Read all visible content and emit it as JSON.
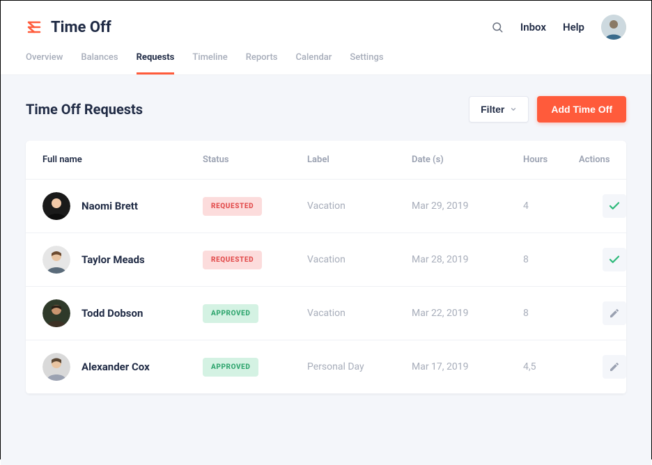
{
  "header": {
    "app_title": "Time Off",
    "links": {
      "inbox": "Inbox",
      "help": "Help"
    }
  },
  "tabs": [
    {
      "label": "Overview"
    },
    {
      "label": "Balances"
    },
    {
      "label": "Requests"
    },
    {
      "label": "Timeline"
    },
    {
      "label": "Reports"
    },
    {
      "label": "Calendar"
    },
    {
      "label": "Settings"
    }
  ],
  "page": {
    "title": "Time Off Requests",
    "filter_label": "Filter",
    "add_label": "Add Time Off"
  },
  "table": {
    "columns": {
      "name": "Full name",
      "status": "Status",
      "label": "Label",
      "date": "Date (s)",
      "hours": "Hours",
      "actions": "Actions"
    },
    "rows": [
      {
        "name": "Naomi Brett",
        "status": "REQUESTED",
        "status_kind": "requested",
        "label": "Vacation",
        "date": "Mar 29, 2019",
        "hours": "4",
        "action_set": "pending"
      },
      {
        "name": "Taylor Meads",
        "status": "REQUESTED",
        "status_kind": "requested",
        "label": "Vacation",
        "date": "Mar 28, 2019",
        "hours": "8",
        "action_set": "pending"
      },
      {
        "name": "Todd Dobson",
        "status": "APPROVED",
        "status_kind": "approved",
        "label": "Vacation",
        "date": "Mar 22, 2019",
        "hours": "8",
        "action_set": "edit"
      },
      {
        "name": "Alexander Cox",
        "status": "APPROVED",
        "status_kind": "approved",
        "label": "Personal Day",
        "date": "Mar 17, 2019",
        "hours": "4,5",
        "action_set": "edit"
      }
    ]
  },
  "colors": {
    "accent": "#ff5b3b",
    "approved_bg": "#d4f2e3",
    "approved_fg": "#2fa56e",
    "requested_bg": "#fcdcdc",
    "requested_fg": "#e24b4b"
  }
}
